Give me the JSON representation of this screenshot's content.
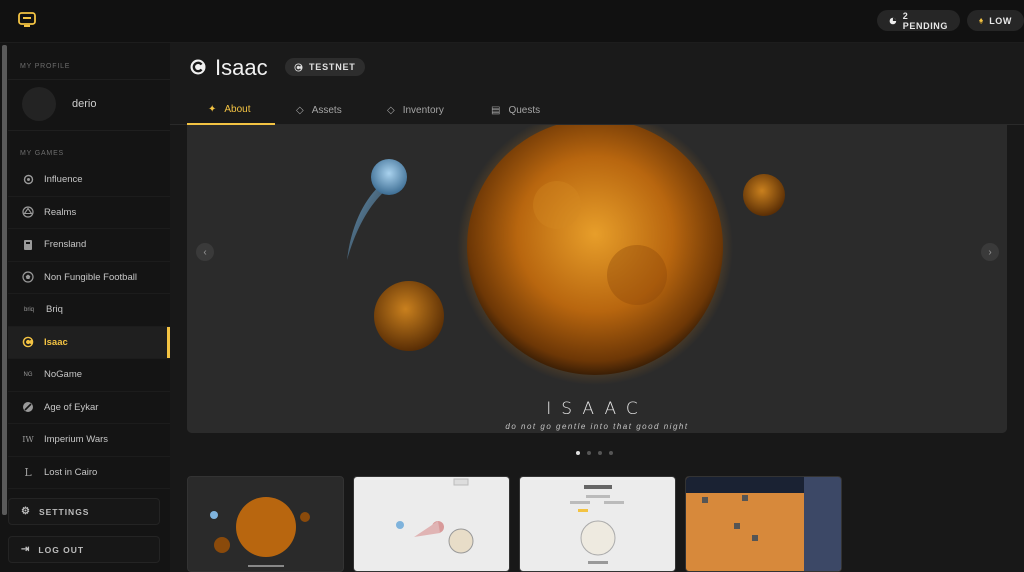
{
  "topbar": {
    "pending_label": "2 PENDING",
    "gas_label": "LOW"
  },
  "sidebar": {
    "profile_title": "MY PROFILE",
    "username": "derio",
    "games_title": "MY GAMES",
    "games": [
      {
        "label": "Influence",
        "icon": "influence-icon"
      },
      {
        "label": "Realms",
        "icon": "realms-icon"
      },
      {
        "label": "Frensland",
        "icon": "frensland-icon"
      },
      {
        "label": "Non Fungible Football",
        "icon": "football-icon"
      },
      {
        "label": "Briq",
        "icon": "briq-icon",
        "icon_text": "briq"
      },
      {
        "label": "Isaac",
        "icon": "isaac-icon",
        "active": true
      },
      {
        "label": "NoGame",
        "icon": "nogame-icon",
        "icon_text": "NG"
      },
      {
        "label": "Age of Eykar",
        "icon": "eykar-icon"
      },
      {
        "label": "Imperium Wars",
        "icon": "imperium-icon",
        "icon_text": "IW"
      },
      {
        "label": "Lost in Cairo",
        "icon": "cairo-icon",
        "icon_text": "L"
      }
    ],
    "settings_label": "SETTINGS",
    "logout_label": "LOG OUT"
  },
  "game": {
    "title": "Isaac",
    "network_badge": "TESTNET",
    "tabs": [
      {
        "label": "About",
        "icon": "sparkles-icon",
        "active": true
      },
      {
        "label": "Assets",
        "icon": "diamond-icon"
      },
      {
        "label": "Inventory",
        "icon": "gem-icon"
      },
      {
        "label": "Quests",
        "icon": "scroll-icon"
      }
    ]
  },
  "hero": {
    "title": "ISAAC",
    "subtitle": "do not go gentle into that good night",
    "slide_count": 4,
    "active_slide": 1
  },
  "colors": {
    "accent": "#f3c343",
    "background": "#161616",
    "surface": "#1f1f1f"
  }
}
